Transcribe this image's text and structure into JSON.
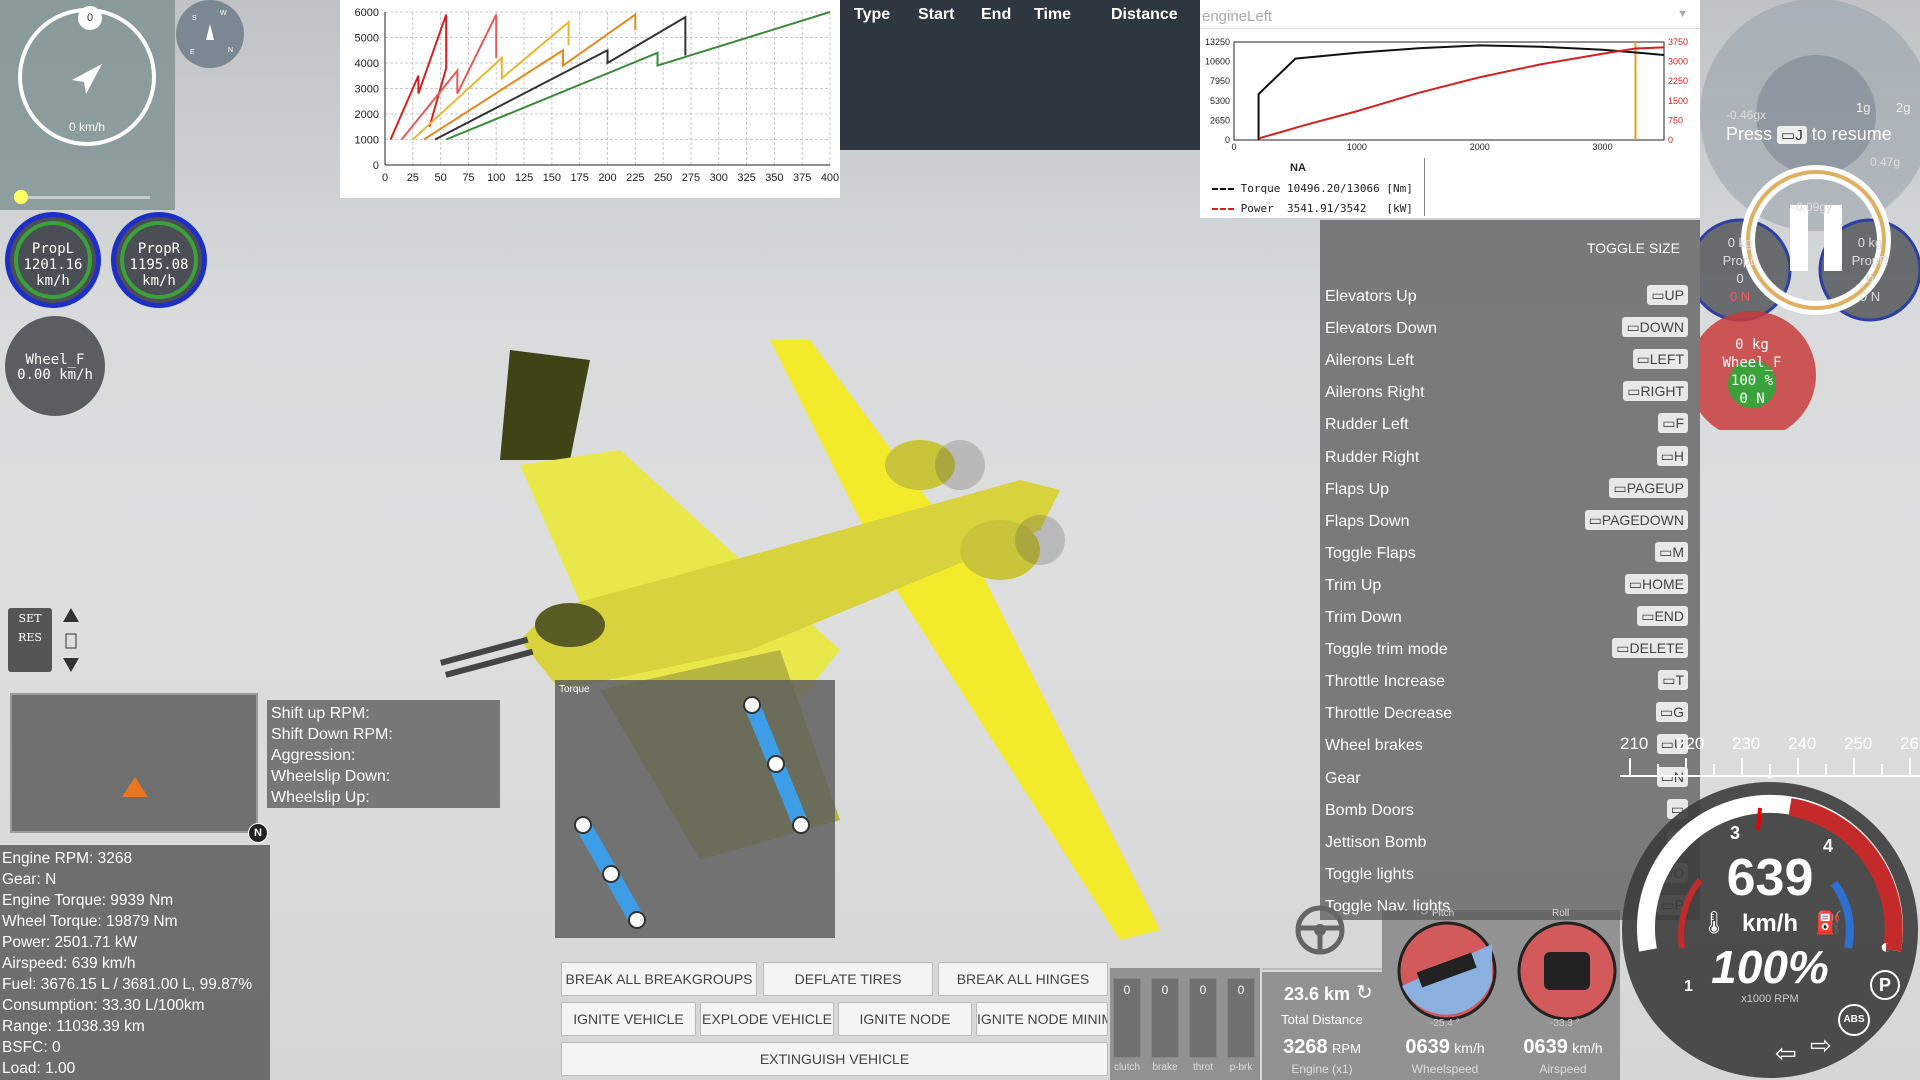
{
  "speed_dial": {
    "top_value": "0",
    "speed": "0 km/h"
  },
  "props": [
    {
      "name": "PropL",
      "value": "1201.16 km/h"
    },
    {
      "name": "PropR",
      "value": "1195.08 km/h"
    }
  ],
  "wheel_front": {
    "name": "Wheel_F",
    "value": "0.00 km/h"
  },
  "cruise": {
    "set": "SET",
    "res": "RES"
  },
  "chart_data": [
    {
      "type": "line",
      "yticks": [
        0,
        1000,
        2000,
        3000,
        4000,
        5000,
        6000
      ],
      "xticks": [
        0,
        25,
        50,
        75,
        100,
        125,
        150,
        175,
        200,
        225,
        250,
        275,
        300,
        325,
        350,
        375,
        400
      ],
      "ylim": [
        0,
        6000
      ],
      "xlim": [
        0,
        400
      ],
      "grid": true,
      "series": [
        {
          "color": "#d62020",
          "x": [
            5,
            30,
            30,
            55,
            55,
            40
          ],
          "y": [
            1000,
            3500,
            2800,
            5900,
            3800,
            1500
          ]
        },
        {
          "color": "#e45a5a",
          "x": [
            15,
            65,
            65,
            100,
            100
          ],
          "y": [
            1000,
            3700,
            2800,
            5900,
            4200
          ]
        },
        {
          "color": "#e6b830",
          "x": [
            25,
            105,
            105,
            165,
            165
          ],
          "y": [
            1000,
            4200,
            3400,
            5600,
            4700
          ]
        },
        {
          "color": "#e08a20",
          "x": [
            35,
            160,
            160,
            225,
            225
          ],
          "y": [
            1000,
            4500,
            3900,
            5900,
            5300
          ]
        },
        {
          "color": "#333333",
          "x": [
            45,
            200,
            200,
            270,
            270
          ],
          "y": [
            1000,
            4500,
            4000,
            5800,
            4300
          ]
        },
        {
          "color": "#3a8a3a",
          "x": [
            55,
            245,
            245,
            400
          ],
          "y": [
            1000,
            4400,
            3900,
            6000
          ]
        }
      ]
    },
    {
      "type": "line",
      "title": "engineLeft",
      "yticks_left": [
        0,
        2650,
        5300,
        7950,
        10600,
        13250
      ],
      "yticks_right": [
        0,
        750,
        1500,
        2250,
        3000,
        3750
      ],
      "xticks": [
        0,
        1000,
        2000,
        3000
      ],
      "xlim": [
        0,
        3500
      ],
      "series": [
        {
          "name": "Torque",
          "color": "#111111",
          "x": [
            200,
            200,
            500,
            1000,
            1500,
            2000,
            2500,
            3000,
            3500
          ],
          "y": [
            0,
            6200,
            11000,
            11800,
            12400,
            12800,
            12600,
            12200,
            11500
          ]
        },
        {
          "name": "Power",
          "color": "#d62020",
          "x": [
            200,
            600,
            1000,
            1500,
            2000,
            2500,
            3000,
            3268,
            3500
          ],
          "y": [
            60,
            600,
            1100,
            1800,
            2400,
            2900,
            3300,
            3500,
            3542
          ]
        }
      ],
      "marker_x": 3268
    }
  ],
  "table_header": [
    "Type",
    "Start",
    "End",
    "Time",
    "Distance"
  ],
  "engine_legend": {
    "na": "NA",
    "torque": "Torque 10496.20/13066 [Nm]",
    "power": "Power  3541.91/3542   [kW]"
  },
  "keylist": {
    "toggle": "TOGGLE SIZE",
    "items": [
      {
        "label": "Elevators Up",
        "key": "UP"
      },
      {
        "label": "Elevators Down",
        "key": "DOWN"
      },
      {
        "label": "Ailerons Left",
        "key": "LEFT"
      },
      {
        "label": "Ailerons Right",
        "key": "RIGHT"
      },
      {
        "label": "Rudder Left",
        "key": "F"
      },
      {
        "label": "Rudder Right",
        "key": "H"
      },
      {
        "label": "Flaps Up",
        "key": "PAGEUP"
      },
      {
        "label": "Flaps Down",
        "key": "PAGEDOWN"
      },
      {
        "label": "Toggle Flaps",
        "key": "M"
      },
      {
        "label": "Trim Up",
        "key": "HOME"
      },
      {
        "label": "Trim Down",
        "key": "END"
      },
      {
        "label": "Toggle trim mode",
        "key": "DELETE"
      },
      {
        "label": "Throttle Increase",
        "key": "T"
      },
      {
        "label": "Throttle Decrease",
        "key": "G"
      },
      {
        "label": "Wheel brakes",
        "key": "U"
      },
      {
        "label": "Gear",
        "key": "N"
      },
      {
        "label": "Bomb Doors",
        "key": ""
      },
      {
        "label": "Jettison Bomb",
        "key": ""
      },
      {
        "label": "Toggle lights",
        "key": "O"
      },
      {
        "label": "Toggle Nav. lights",
        "key": "P"
      }
    ]
  },
  "pause": {
    "press": "Press",
    "key": "J",
    "resume": "to resume",
    "g1": "1g",
    "g2": "2g",
    "gx": "-0.46gx",
    "gy": "0.47g",
    "gz": "-0.09gy"
  },
  "side_gauges": {
    "left_name": "PropL",
    "left_kg": "0 kg",
    "left_val": "0",
    "left_n": "0 N",
    "right_name": "PropR",
    "right_kg": "0 kg",
    "right_val": "0",
    "right_n": "0 N",
    "wheel_kg": "0 kg",
    "wheel_name": "Wheel_F",
    "wheel_pct": "100 %",
    "wheel_n": "0 N"
  },
  "heading_tape": [
    "210",
    "220",
    "230",
    "240",
    "250",
    "26"
  ],
  "speedo": {
    "speed": "639",
    "unit": "km/h",
    "throttle": "100%",
    "rpm_unit": "x1000 RPM",
    "gear_3": "3",
    "gear_4": "4",
    "gear_1": "1",
    "park": "P",
    "abs": "ABS"
  },
  "shift_box": [
    "Shift up RPM:",
    "Shift Down RPM:",
    "Aggression:",
    "Wheelslip Down:",
    "Wheelslip Up:"
  ],
  "torque_title": "Torque",
  "info": [
    "Engine RPM: 3268",
    "Gear: N",
    "Engine Torque: 9939 Nm",
    "Wheel Torque: 19879 Nm",
    "Power: 2501.71 kW",
    "Airspeed: 639 km/h",
    "Fuel: 3676.15 L / 3681.00 L, 99.87%",
    "Consumption: 33.30 L/100km",
    "Range: 11038.39 km",
    "BSFC: 0",
    "Load: 1.00"
  ],
  "minimap": {
    "north": "N"
  },
  "buttons": {
    "break_all_breakgroups": "BREAK ALL BREAKGROUPS",
    "deflate_tires": "DEFLATE TIRES",
    "break_all_hinges": "BREAK ALL HINGES",
    "ignite_vehicle": "IGNITE VEHICLE",
    "explode_vehicle": "EXPLODE VEHICLE",
    "ignite_node": "IGNITE NODE",
    "ignite_node_minimal": "IGNITE NODE MINIM",
    "extinguish_vehicle": "EXTINGUISH VEHICLE"
  },
  "pedals": [
    {
      "value": "0",
      "label": "clutch"
    },
    {
      "value": "0",
      "label": "brake"
    },
    {
      "value": "0",
      "label": "throt"
    },
    {
      "value": "0",
      "label": "p-brk"
    }
  ],
  "trip": {
    "distance": "23.6 km",
    "distance_label": "Total Distance",
    "rpm": "3268",
    "rpm_unit": "RPM",
    "rpm_label": "Engine (x1)"
  },
  "attitude": {
    "pitch_label": "Pitch",
    "pitch_val": "-25.4 °",
    "roll_label": "Roll",
    "roll_val": "-33.3 °"
  },
  "speeds": {
    "wheel": "0639",
    "wheel_unit": "km/h",
    "wheel_label": "Wheelspeed",
    "air": "0639",
    "air_unit": "km/h",
    "air_label": "Airspeed"
  }
}
